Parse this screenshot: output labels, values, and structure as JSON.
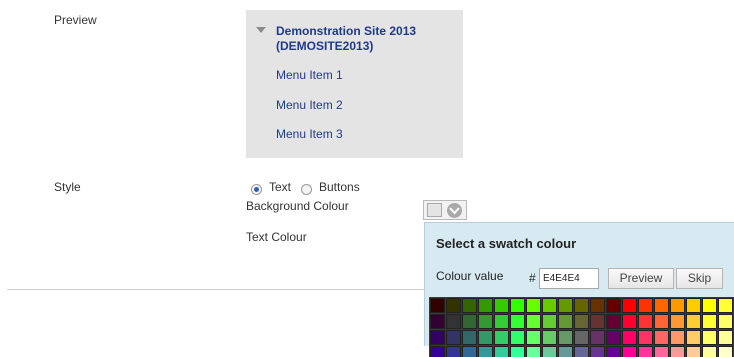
{
  "preview": {
    "label": "Preview",
    "site_title": "Demonstration Site 2013 (DEMOSITE2013)",
    "menu_items": [
      "Menu Item 1",
      "Menu Item 2",
      "Menu Item 3"
    ]
  },
  "style": {
    "label": "Style",
    "option_text": "Text",
    "option_buttons": "Buttons",
    "selected": "Text",
    "background_colour_label": "Background Colour",
    "text_colour_label": "Text Colour",
    "background_colour_value": "#E4E4E4"
  },
  "swatch_popup": {
    "title": "Select a swatch colour",
    "colour_value_label": "Colour value",
    "hash": "#",
    "colour_value": "E4E4E4",
    "preview_button": "Preview",
    "skip_button": "Skip"
  },
  "swatch_rows": [
    [
      "#330000",
      "#333300",
      "#336600",
      "#339900",
      "#33cc00",
      "#33ff00",
      "#66ff00",
      "#66cc00",
      "#669900",
      "#666600",
      "#663300",
      "#660000",
      "#ff0000",
      "#ff3300",
      "#ff6600",
      "#ff9900",
      "#ffcc00",
      "#ffff00",
      "#ffff33"
    ],
    [
      "#330033",
      "#333333",
      "#336633",
      "#339933",
      "#33cc33",
      "#33ff33",
      "#66ff33",
      "#66cc33",
      "#669933",
      "#666633",
      "#663333",
      "#660033",
      "#ff0033",
      "#ff3333",
      "#ff6633",
      "#ff9933",
      "#ffcc33",
      "#ffff33",
      "#ffff66"
    ],
    [
      "#330066",
      "#333366",
      "#336666",
      "#339966",
      "#33cc66",
      "#33ff66",
      "#66ff66",
      "#66cc66",
      "#669966",
      "#666666",
      "#663366",
      "#660066",
      "#ff0066",
      "#ff3366",
      "#ff6666",
      "#ff9966",
      "#ffcc66",
      "#ffff66",
      "#ffff99"
    ],
    [
      "#330099",
      "#333399",
      "#336699",
      "#339999",
      "#33cc99",
      "#33ff99",
      "#66ff99",
      "#66cc99",
      "#669999",
      "#666699",
      "#663399",
      "#660099",
      "#ff0099",
      "#ff3399",
      "#ff6699",
      "#ff9999",
      "#ffcc99",
      "#ffff99",
      "#ffffcc"
    ]
  ]
}
